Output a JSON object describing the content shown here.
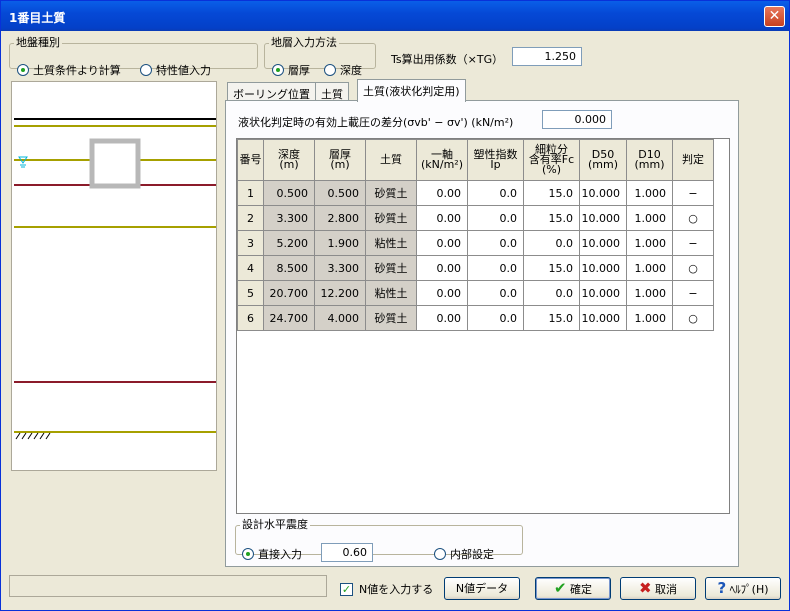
{
  "window": {
    "title": "1番目土質"
  },
  "ground_type": {
    "legend": "地盤種別",
    "options": [
      {
        "label": "土質条件より計算",
        "selected": true
      },
      {
        "label": "特性値入力",
        "selected": false
      }
    ]
  },
  "layer_method": {
    "legend": "地層入力方法",
    "options": [
      {
        "label": "層厚",
        "selected": true
      },
      {
        "label": "深度",
        "selected": false
      }
    ]
  },
  "ts": {
    "label": "Ts算出用係数（×TG）",
    "value": "1.250"
  },
  "tabs": [
    {
      "label": "ボーリング位置"
    },
    {
      "label": "土質"
    },
    {
      "label": "土質(液状化判定用)",
      "active": true
    }
  ],
  "pressure": {
    "label": "液状化判定時の有効上載圧の差分(σvb' − σv') (kN/m²)",
    "value": "0.000"
  },
  "table": {
    "headers": [
      [
        "番号"
      ],
      [
        "深度",
        "(m)"
      ],
      [
        "層厚",
        "(m)"
      ],
      [
        "土質"
      ],
      [
        "一軸",
        "(kN/m²)"
      ],
      [
        "塑性指数",
        "Ip"
      ],
      [
        "細粒分",
        "含有率Fc",
        "(%)"
      ],
      [
        "D50",
        "(mm)"
      ],
      [
        "D10",
        "(mm)"
      ],
      [
        "判定"
      ]
    ],
    "rows": [
      [
        "1",
        "0.500",
        "0.500",
        "砂質土",
        "0.00",
        "0.0",
        "15.0",
        "10.000",
        "1.000",
        "−"
      ],
      [
        "2",
        "3.300",
        "2.800",
        "砂質土",
        "0.00",
        "0.0",
        "15.0",
        "10.000",
        "1.000",
        "○"
      ],
      [
        "3",
        "5.200",
        "1.900",
        "粘性土",
        "0.00",
        "0.0",
        "0.0",
        "10.000",
        "1.000",
        "−"
      ],
      [
        "4",
        "8.500",
        "3.300",
        "砂質土",
        "0.00",
        "0.0",
        "15.0",
        "10.000",
        "1.000",
        "○"
      ],
      [
        "5",
        "20.700",
        "12.200",
        "粘性土",
        "0.00",
        "0.0",
        "0.0",
        "10.000",
        "1.000",
        "−"
      ],
      [
        "6",
        "24.700",
        "4.000",
        "砂質土",
        "0.00",
        "0.0",
        "15.0",
        "10.000",
        "1.000",
        "○"
      ]
    ]
  },
  "seismic": {
    "legend": "設計水平震度",
    "direct_label": "直接入力",
    "direct_selected": true,
    "value": "0.60",
    "internal_label": "内部設定"
  },
  "footer": {
    "n_check_label": "N値を入力する",
    "n_checked": true,
    "n_data_button": "N値データ",
    "ok": "確定",
    "cancel": "取消",
    "help": "ﾍﾙﾌﾟ(H)"
  },
  "colors": {
    "title_bar": "#0549d6",
    "layer_yellow": "#a6a000",
    "layer_red": "#8b1b2a",
    "water": "#00b4d8"
  }
}
